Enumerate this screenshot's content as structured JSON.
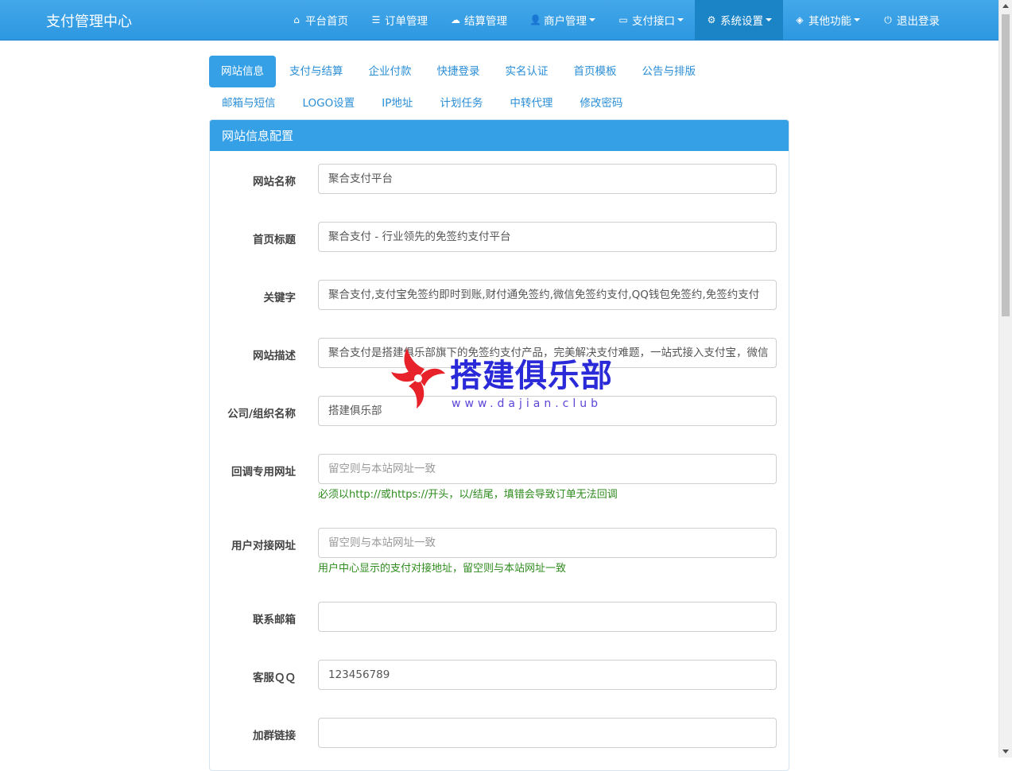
{
  "brand": "支付管理中心",
  "nav": [
    {
      "icon": "home-icon",
      "glyph": "⌂",
      "label": "平台首页",
      "dropdown": false,
      "active": false
    },
    {
      "icon": "list-icon",
      "glyph": "☰",
      "label": "订单管理",
      "dropdown": false,
      "active": false
    },
    {
      "icon": "cloud-icon",
      "glyph": "☁",
      "label": "结算管理",
      "dropdown": false,
      "active": false
    },
    {
      "icon": "user-icon",
      "glyph": "👤",
      "label": "商户管理",
      "dropdown": true,
      "active": false
    },
    {
      "icon": "credit-card-icon",
      "glyph": "▭",
      "label": "支付接口",
      "dropdown": true,
      "active": false
    },
    {
      "icon": "gear-icon",
      "glyph": "⚙",
      "label": "系统设置",
      "dropdown": true,
      "active": true
    },
    {
      "icon": "cube-icon",
      "glyph": "◈",
      "label": "其他功能",
      "dropdown": true,
      "active": false
    },
    {
      "icon": "power-icon",
      "glyph": "⏻",
      "label": "退出登录",
      "dropdown": false,
      "active": false
    }
  ],
  "tabs_row1": [
    "网站信息",
    "支付与结算",
    "企业付款",
    "快捷登录",
    "实名认证",
    "首页模板",
    "公告与排版"
  ],
  "tabs_row2": [
    "邮箱与短信",
    "LOGO设置",
    "IP地址",
    "计划任务",
    "中转代理",
    "修改密码"
  ],
  "active_tab": "网站信息",
  "panel_title": "网站信息配置",
  "fields": [
    {
      "name": "site-name",
      "label": "网站名称",
      "value": "聚合支付平台",
      "placeholder": "",
      "help": ""
    },
    {
      "name": "home-title",
      "label": "首页标题",
      "value": "聚合支付 - 行业领先的免签约支付平台",
      "placeholder": "",
      "help": ""
    },
    {
      "name": "keywords",
      "label": "关键字",
      "value": "聚合支付,支付宝免签约即时到账,财付通免签约,微信免签约支付,QQ钱包免签约,免签约支付",
      "placeholder": "",
      "help": ""
    },
    {
      "name": "site-description",
      "label": "网站描述",
      "value": "聚合支付是搭建俱乐部旗下的免签约支付产品，完美解决支付难题，一站式接入支付宝，微信",
      "placeholder": "",
      "help": ""
    },
    {
      "name": "company-name",
      "label": "公司/组织名称",
      "value": "搭建俱乐部",
      "placeholder": "",
      "help": ""
    },
    {
      "name": "callback-url",
      "label": "回调专用网址",
      "value": "",
      "placeholder": "留空则与本站网址一致",
      "help": "必须以http://或https://开头，以/结尾，填错会导致订单无法回调"
    },
    {
      "name": "user-api-url",
      "label": "用户对接网址",
      "value": "",
      "placeholder": "留空则与本站网址一致",
      "help": "用户中心显示的支付对接地址，留空则与本站网址一致"
    },
    {
      "name": "contact-email",
      "label": "联系邮箱",
      "value": "",
      "placeholder": "",
      "help": ""
    },
    {
      "name": "service-qq",
      "label": "客服ＱＱ",
      "value": "123456789",
      "placeholder": "",
      "help": ""
    },
    {
      "name": "group-link",
      "label": "加群链接",
      "value": "",
      "placeholder": "",
      "help": ""
    }
  ],
  "watermark": {
    "text": "搭建俱乐部",
    "url": "www.dajian.club"
  }
}
